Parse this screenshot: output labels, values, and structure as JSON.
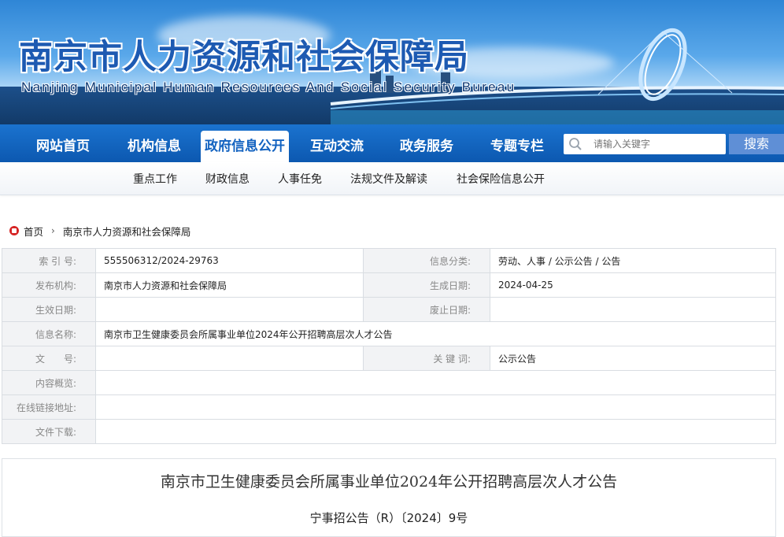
{
  "header": {
    "title_cn": "南京市人力资源和社会保障局",
    "title_en": "Nanjing Municipal Human Resources And Social Security Bureau"
  },
  "nav": {
    "items": [
      "网站首页",
      "机构信息",
      "政府信息公开",
      "互动交流",
      "政务服务",
      "专题专栏"
    ],
    "active": "政府信息公开",
    "search_placeholder": "请输入关键字",
    "search_button": "搜索"
  },
  "subnav": {
    "items": [
      "重点工作",
      "财政信息",
      "人事任免",
      "法规文件及解读",
      "社会保险信息公开"
    ]
  },
  "breadcrumb": {
    "home": "首页",
    "current": "南京市人力资源和社会保障局"
  },
  "info": {
    "index_label": "索 引 号:",
    "index_value": "555506312/2024-29763",
    "category_label": "信息分类:",
    "category_value": "劳动、人事 / 公示公告 / 公告",
    "publisher_label": "发布机构:",
    "publisher_value": "南京市人力资源和社会保障局",
    "created_label": "生成日期:",
    "created_value": "2024-04-25",
    "effective_label": "生效日期:",
    "effective_value": "",
    "expire_label": "废止日期:",
    "expire_value": "",
    "name_label": "信息名称:",
    "name_value": "南京市卫生健康委员会所属事业单位2024年公开招聘高层次人才公告",
    "docno_label": "文　　号:",
    "docno_value": "",
    "keyword_label": "关 键 词:",
    "keyword_value": "公示公告",
    "summary_label": "内容概览:",
    "summary_value": "",
    "link_label": "在线链接地址:",
    "link_value": "",
    "download_label": "文件下载:",
    "download_value": ""
  },
  "article": {
    "title": "南京市卫生健康委员会所属事业单位2024年公开招聘高层次人才公告",
    "doc_number": "宁事招公告（R）〔2024〕9号"
  },
  "colors": {
    "nav_blue": "#0c58b0",
    "active_text": "#1262c0",
    "search_button": "#5f8fd6",
    "crumb_icon": "#d62424"
  }
}
